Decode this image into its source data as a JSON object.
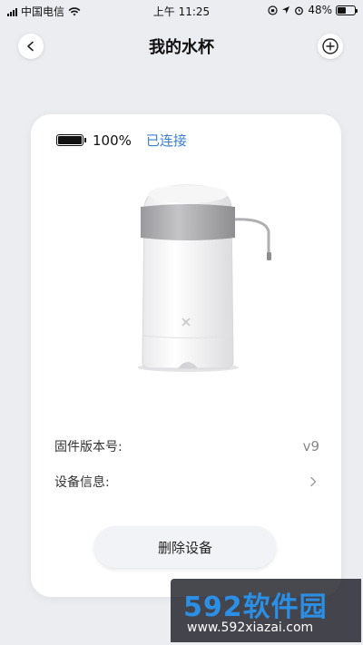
{
  "status_bar": {
    "carrier": "中国电信",
    "time": "上午 11:25",
    "battery_percent": "48%",
    "battery_level": 0.48
  },
  "header": {
    "title": "我的水杯",
    "back_icon": "chevron-left-icon",
    "add_icon": "plus-circle-icon"
  },
  "device": {
    "battery_percent": "100%",
    "battery_level": 1.0,
    "connection_status": "已连接",
    "connection_color": "#3b7fd0"
  },
  "info": {
    "firmware_label": "固件版本号:",
    "firmware_value": "v9",
    "device_info_label": "设备信息:"
  },
  "actions": {
    "delete_label": "删除设备"
  },
  "watermark": {
    "title": "592软件园",
    "url": "www.592xiazai.com"
  }
}
